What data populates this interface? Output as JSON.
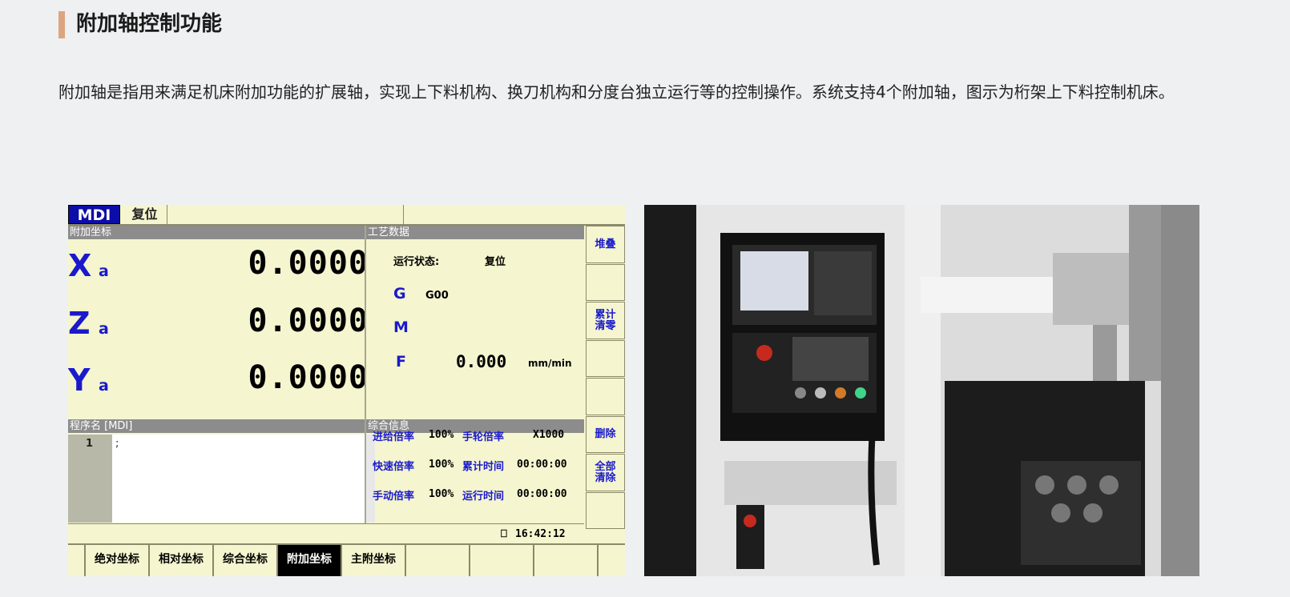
{
  "section": {
    "title": "附加轴控制功能",
    "description": "附加轴是指用来满足机床附加功能的扩展轴，实现上下料机构、换刀机构和分度台独立运行等的控制操作。系统支持4个附加轴，图示为桁架上下料控制机床。"
  },
  "cnc": {
    "mode_badge": "MDI",
    "state": "复位",
    "panel_axes_title": "附加坐标",
    "axes": [
      {
        "name": "X",
        "sub": "a",
        "value": "0.0000"
      },
      {
        "name": "Z",
        "sub": "a",
        "value": "0.0000"
      },
      {
        "name": "Y",
        "sub": "a",
        "value": "0.0000"
      }
    ],
    "process_title": "工艺数据",
    "run_state_label": "运行状态:",
    "run_state_value": "复位",
    "g_label": "G",
    "g_value": "G00",
    "m_label": "M",
    "f_label": "F",
    "f_value": "0.000",
    "f_unit": "mm/min",
    "program_title": "程序名 [MDI]",
    "program_lines": [
      {
        "num": "1",
        "code": ";"
      }
    ],
    "info_title": "综合信息",
    "info": [
      {
        "l1": "进给倍率",
        "v1": "100%",
        "l2": "手轮倍率",
        "v2": "X1000"
      },
      {
        "l1": "快速倍率",
        "v1": "100%",
        "l2": "累计时间",
        "v2": "00:00:00"
      },
      {
        "l1": "手动倍率",
        "v1": "100%",
        "l2": "运行时间",
        "v2": "00:00:00"
      }
    ],
    "clock": "16:42:12",
    "softkeys": [
      "堆叠",
      "",
      "累计\n清零",
      "",
      "",
      "删除",
      "全部\n清除",
      ""
    ],
    "tabs": [
      "",
      "绝对坐标",
      "相对坐标",
      "综合坐标",
      "附加坐标",
      "主附坐标",
      "",
      "",
      "",
      ""
    ],
    "active_tab": "附加坐标",
    "colors": {
      "bg": "#f5f5cf",
      "accent": "#1a1acc",
      "mdi": "#0c0ca8"
    }
  }
}
